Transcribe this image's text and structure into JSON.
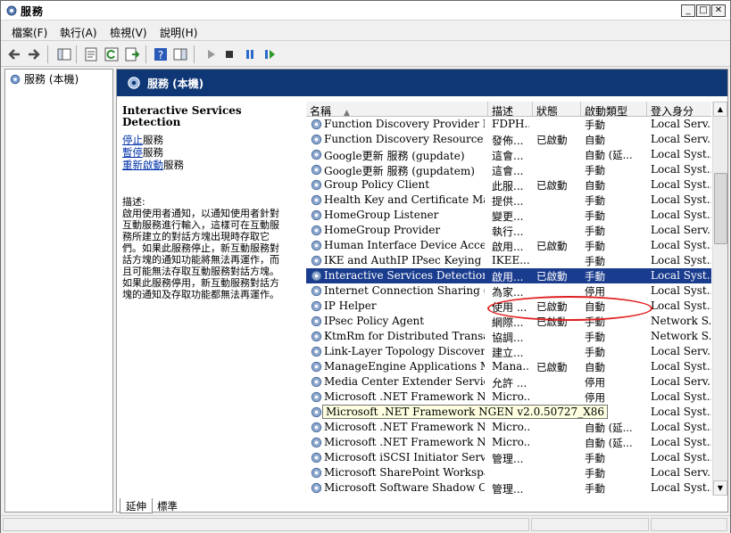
{
  "window": {
    "title": "服務"
  },
  "menu": [
    {
      "label": "檔案(F)"
    },
    {
      "label": "執行(A)"
    },
    {
      "label": "檢視(V)"
    },
    {
      "label": "說明(H)"
    }
  ],
  "tree": {
    "root": "服務 (本機)"
  },
  "pane": {
    "title": "服務 (本機)"
  },
  "details": {
    "service_name": "Interactive Services Detection",
    "links": [
      {
        "link": "停止",
        "rest": "服務"
      },
      {
        "link": "暫停",
        "rest": "服務"
      },
      {
        "link": "重新啟動",
        "rest": "服務"
      }
    ],
    "desc_label": "描述:",
    "desc_lines": [
      "啟用使用者通知，以通知使用者針對",
      "互動服務進行輸入，這樣可在互動服",
      "務所建立的對話方塊出現時存取它",
      "們。如果此服務停止，新互動服務對",
      "話方塊的通知功能將無法再運作，而",
      "且可能無法存取互動服務對話方塊。",
      "如果此服務停用，新互動服務對話方",
      "塊的通知及存取功能都無法再運作。"
    ]
  },
  "columns": [
    {
      "label": "名稱"
    },
    {
      "label": "描述"
    },
    {
      "label": "狀態"
    },
    {
      "label": "啟動類型"
    },
    {
      "label": "登入身分"
    }
  ],
  "services": [
    {
      "name": "Function Discovery Provider Host",
      "desc": "FDPH...",
      "status": "",
      "startup": "手動",
      "logon": "Local Serv..."
    },
    {
      "name": "Function Discovery Resource Public...",
      "desc": "發佈...",
      "status": "已啟動",
      "startup": "自動",
      "logon": "Local Serv..."
    },
    {
      "name": "Google更新 服務 (gupdate)",
      "desc": "這會...",
      "status": "",
      "startup": "自動 (延...",
      "logon": "Local Syst..."
    },
    {
      "name": "Google更新 服務 (gupdatem)",
      "desc": "這會...",
      "status": "",
      "startup": "手動",
      "logon": "Local Syst..."
    },
    {
      "name": "Group Policy Client",
      "desc": "此服...",
      "status": "已啟動",
      "startup": "自動",
      "logon": "Local Syst..."
    },
    {
      "name": "Health Key and Certificate Manage...",
      "desc": "提供...",
      "status": "",
      "startup": "手動",
      "logon": "Local Syst..."
    },
    {
      "name": "HomeGroup Listener",
      "desc": "變更...",
      "status": "",
      "startup": "手動",
      "logon": "Local Syst..."
    },
    {
      "name": "HomeGroup Provider",
      "desc": "執行...",
      "status": "",
      "startup": "手動",
      "logon": "Local Serv..."
    },
    {
      "name": "Human Interface Device Access",
      "desc": "啟用...",
      "status": "已啟動",
      "startup": "手動",
      "logon": "Local Syst..."
    },
    {
      "name": "IKE and AuthIP IPsec Keying Modu...",
      "desc": "IKEE...",
      "status": "",
      "startup": "手動",
      "logon": "Local Syst..."
    },
    {
      "name": "Interactive Services Detection",
      "desc": "啟用...",
      "status": "已啟動",
      "startup": "手動",
      "logon": "Local Syst...",
      "selected": true
    },
    {
      "name": "Internet Connection Sharing (ICS)",
      "desc": "為家...",
      "status": "",
      "startup": "停用",
      "logon": "Local Syst..."
    },
    {
      "name": "IP Helper",
      "desc": "使用 ...",
      "status": "已啟動",
      "startup": "自動",
      "logon": "Local Syst..."
    },
    {
      "name": "IPsec Policy Agent",
      "desc": "網際...",
      "status": "已啟動",
      "startup": "手動",
      "logon": "Network S..."
    },
    {
      "name": "KtmRm for Distributed Transaction ...",
      "desc": "協調...",
      "status": "",
      "startup": "手動",
      "logon": "Network S..."
    },
    {
      "name": "Link-Layer Topology Discovery Ma...",
      "desc": "建立...",
      "status": "",
      "startup": "手動",
      "logon": "Local Serv..."
    },
    {
      "name": "ManageEngine Applications Manager",
      "desc": "Mana...",
      "status": "已啟動",
      "startup": "自動",
      "logon": "Local Syst..."
    },
    {
      "name": "Media Center Extender Service",
      "desc": "允許 ...",
      "status": "",
      "startup": "停用",
      "logon": "Local Serv..."
    },
    {
      "name": "Microsoft .NET Framework NGEN ...",
      "desc": "Micro...",
      "status": "",
      "startup": "停用",
      "logon": "Local Syst..."
    },
    {
      "name": "Microsoft .NET Framework NGEN ...",
      "desc": "Micro...",
      "status": "",
      "startup": "停用",
      "logon": "Local Syst...",
      "tooltip": "Microsoft .NET Framework NGEN v2.0.50727_X86"
    },
    {
      "name": "Microsoft .NET Framework NGEN ...",
      "desc": "Micro...",
      "status": "",
      "startup": "自動 (延...",
      "logon": "Local Syst..."
    },
    {
      "name": "Microsoft .NET Framework NGEN ...",
      "desc": "Micro...",
      "status": "",
      "startup": "自動 (延...",
      "logon": "Local Syst..."
    },
    {
      "name": "Microsoft iSCSI Initiator Service",
      "desc": "管理...",
      "status": "",
      "startup": "手動",
      "logon": "Local Syst..."
    },
    {
      "name": "Microsoft SharePoint Workspace Au...",
      "desc": "",
      "status": "",
      "startup": "手動",
      "logon": "Local Serv..."
    },
    {
      "name": "Microsoft Software Shadow Copy P...",
      "desc": "管理...",
      "status": "",
      "startup": "手動",
      "logon": "Local Syst..."
    }
  ],
  "tabs": [
    {
      "label": "延伸"
    },
    {
      "label": "標準"
    }
  ],
  "colors": {
    "header_bg": "#0f3675",
    "selection": "#1a3c8e",
    "highlight_circle": "#e02020"
  }
}
